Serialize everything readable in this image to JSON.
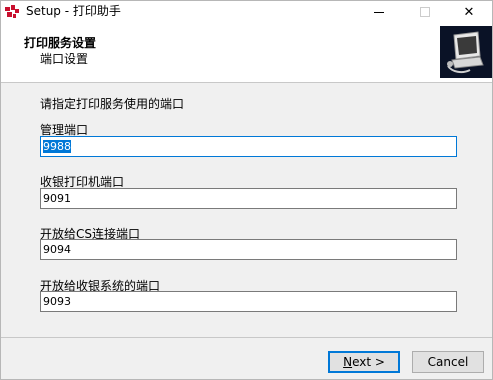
{
  "window": {
    "title": "Setup - 打印助手",
    "minimize_icon": "minimize-icon",
    "maximize_icon": "maximize-icon",
    "close_icon": "close-icon",
    "close_glyph": "✕"
  },
  "header": {
    "title": "打印服务设置",
    "subtitle": "端口设置",
    "logo_icon": "installer-computer-icon"
  },
  "main": {
    "instruction": "请指定打印服务使用的端口",
    "fields": [
      {
        "label": "管理端口",
        "value": "9988",
        "selected": true
      },
      {
        "label": "收银打印机端口",
        "value": "9091",
        "selected": false
      },
      {
        "label": "开放给CS连接端口",
        "value": "9094",
        "selected": false
      },
      {
        "label": "开放给收银系统的端口",
        "value": "9093",
        "selected": false
      }
    ]
  },
  "buttons": {
    "next_mnemonic": "N",
    "next_rest": "ext >",
    "cancel": "Cancel"
  },
  "colors": {
    "accent": "#0078d7",
    "header_bg": "#ffffff",
    "body_bg": "#f0f0f0",
    "logo_bg": "#0a1226"
  }
}
